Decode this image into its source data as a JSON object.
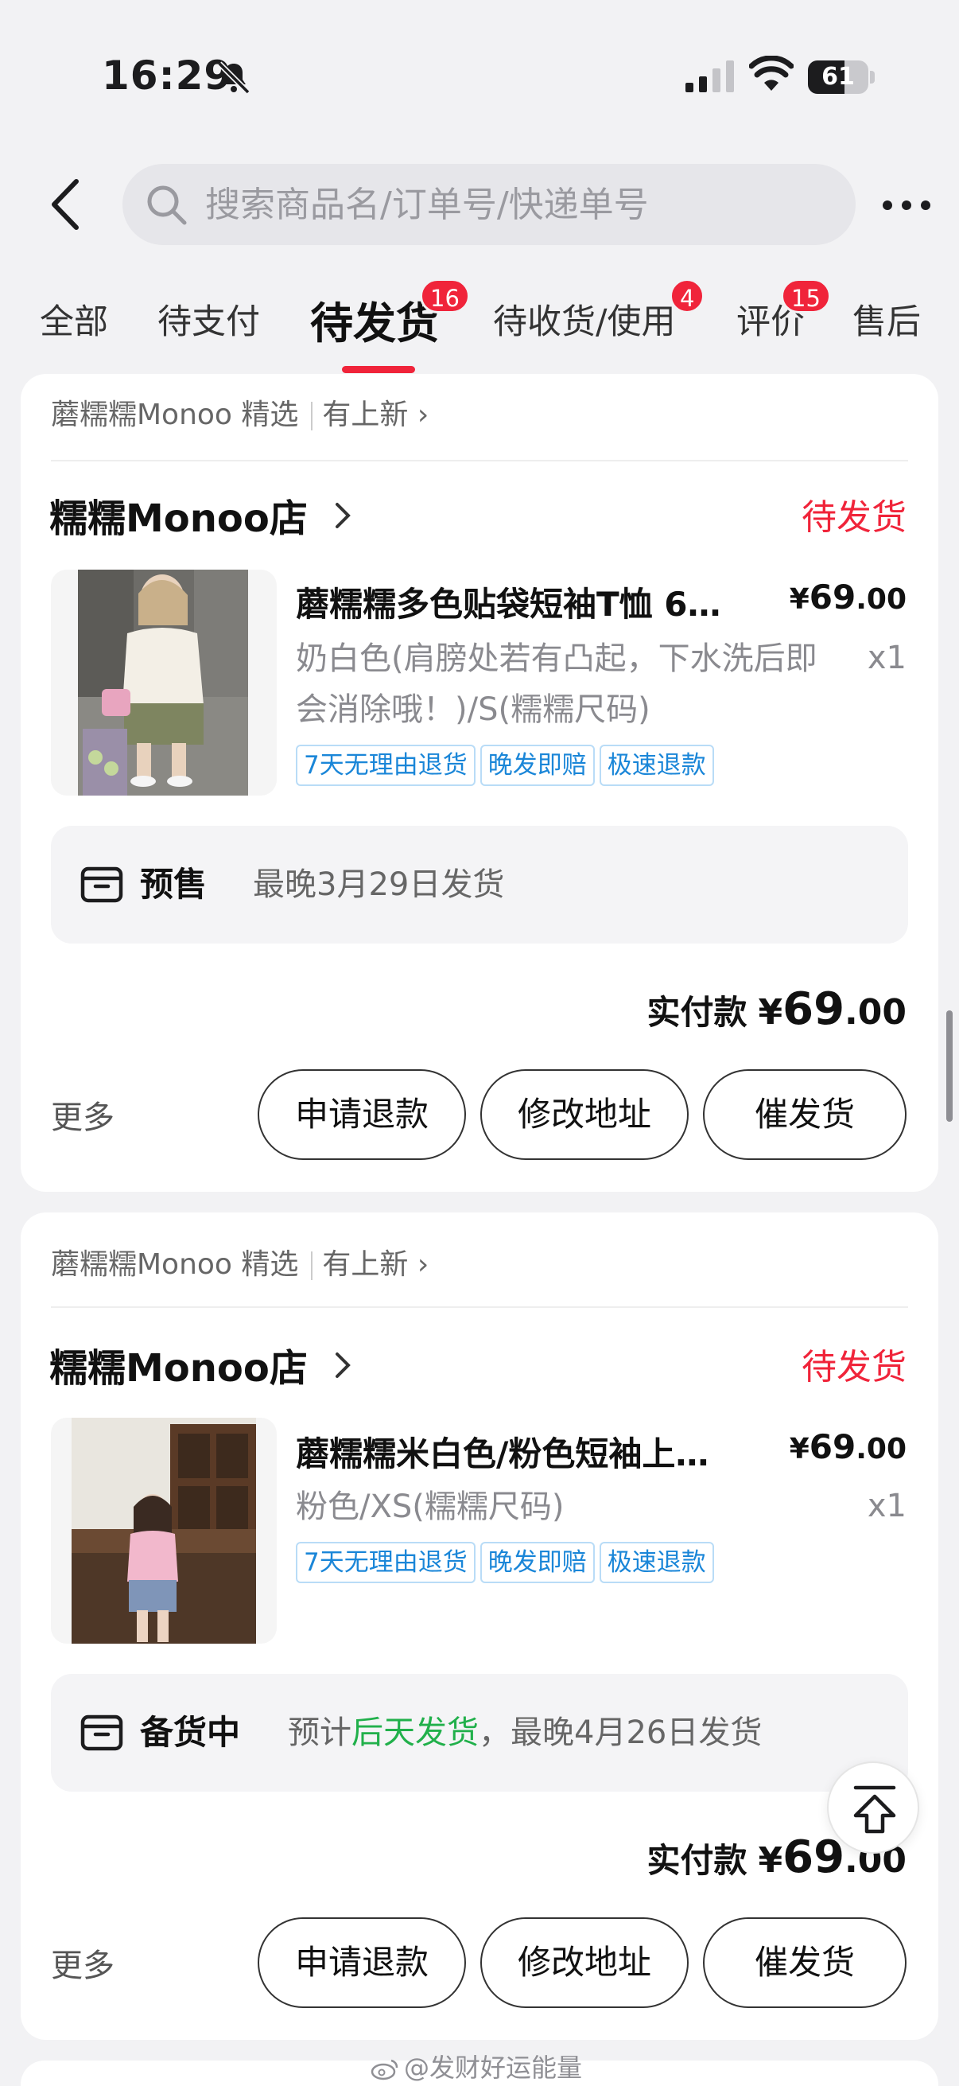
{
  "status_bar": {
    "time": "16:29",
    "battery": "61",
    "battery_level": 0.61
  },
  "search": {
    "placeholder": "搜索商品名/订单号/快递单号"
  },
  "tabs": [
    {
      "label": "全部"
    },
    {
      "label": "待支付"
    },
    {
      "label": "待发货",
      "badge": "16",
      "active": true
    },
    {
      "label": "待收货/使用",
      "badge": "4"
    },
    {
      "label": "评价",
      "badge": "15"
    },
    {
      "label": "售后"
    }
  ],
  "orders": [
    {
      "brand_line": "蘑糯糯Monoo 精选",
      "new_label": "有上新",
      "shop_name": "糯糯Monoo店",
      "status": "待发货",
      "product_title": "蘑糯糯多色贴袋短袖T恤 6…",
      "price_currency": "¥",
      "price_int": "69",
      "price_dec": ".00",
      "sku": "奶白色(肩膀处若有凸起，下水洗后即会消除哦！)/S(糯糯尺码)",
      "quantity": "x1",
      "tags": [
        "7天无理由退货",
        "晚发即赔",
        "极速退款"
      ],
      "ship_label": "预售",
      "ship_pre": "最晚3月29日发货",
      "ship_green": "",
      "ship_post": "",
      "total_label": "实付款",
      "total_currency": "¥",
      "total_int": "69",
      "total_dec": ".00",
      "more_label": "更多",
      "buttons": [
        "申请退款",
        "修改地址",
        "催发货"
      ]
    },
    {
      "brand_line": "蘑糯糯Monoo 精选",
      "new_label": "有上新",
      "shop_name": "糯糯Monoo店",
      "status": "待发货",
      "product_title": "蘑糯糯米白色/粉色短袖上…",
      "price_currency": "¥",
      "price_int": "69",
      "price_dec": ".00",
      "sku": "粉色/XS(糯糯尺码)",
      "quantity": "x1",
      "tags": [
        "7天无理由退货",
        "晚发即赔",
        "极速退款"
      ],
      "ship_label": "备货中",
      "ship_pre": "预计",
      "ship_green": "后天发货",
      "ship_post": "，最晚4月26日发货",
      "total_label": "实付款",
      "total_currency": "¥",
      "total_int": "69",
      "total_dec": ".00",
      "more_label": "更多",
      "buttons": [
        "申请退款",
        "修改地址",
        "催发货"
      ]
    }
  ],
  "watermark": "@发财好运能量"
}
